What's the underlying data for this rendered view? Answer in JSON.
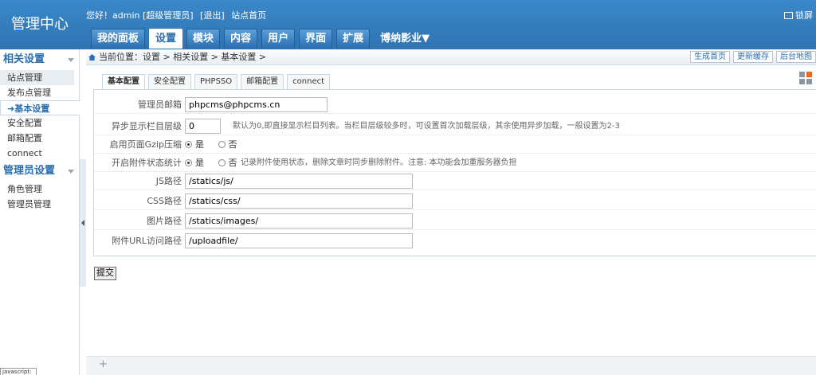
{
  "header": {
    "brand": "管理中心",
    "greeting": "您好！admin [超级管理员]",
    "logout": "[退出]",
    "site_home": "站点首页",
    "lock": "锁屏",
    "nav": [
      {
        "label": "我的面板"
      },
      {
        "label": "设置",
        "active": true
      },
      {
        "label": "模块"
      },
      {
        "label": "内容"
      },
      {
        "label": "用户"
      },
      {
        "label": "界面"
      },
      {
        "label": "扩展"
      },
      {
        "label": "博纳影业▼"
      }
    ]
  },
  "sidebar": {
    "group1": "相关设置",
    "group1_items": [
      "站点管理",
      "发布点管理",
      "➜基本设置",
      "安全配置",
      "邮箱配置",
      "connect"
    ],
    "group2": "管理员设置",
    "group2_items": [
      "角色管理",
      "管理员管理"
    ],
    "js_label": "javascript:"
  },
  "breadcrumb": {
    "text": "当前位置：设置 > 相关设置 > 基本设置 >",
    "buttons": [
      "生成首页",
      "更新缓存",
      "后台地图"
    ]
  },
  "tabs": [
    "基本配置",
    "安全配置",
    "PHPSSO",
    "邮箱配置",
    "connect"
  ],
  "form": {
    "admin_email_label": "管理员邮箱",
    "admin_email_value": "phpcms@phpcms.cn",
    "async_label": "异步显示栏目层级",
    "async_value": "0",
    "async_hint": "默认为0,即直接显示栏目列表。当栏目层级较多时，可设置首次加载层级，其余使用异步加载，一般设置为2-3",
    "gzip_label": "启用页面Gzip压缩",
    "gzip_yes": "是",
    "gzip_no": "否",
    "attach_label": "开启附件状态统计",
    "attach_yes": "是",
    "attach_no": "否",
    "attach_hint": "记录附件使用状态，删除文章时同步删除附件。注意: 本功能会加重服务器负担",
    "js_label": "JS路径",
    "js_value": "/statics/js/",
    "css_label": "CSS路径",
    "css_value": "/statics/css/",
    "img_label": "图片路径",
    "img_value": "/statics/images/",
    "url_label": "附件URL访问路径",
    "url_value": "/uploadfile/",
    "submit": "提交"
  },
  "footer": {
    "plus": "+"
  }
}
